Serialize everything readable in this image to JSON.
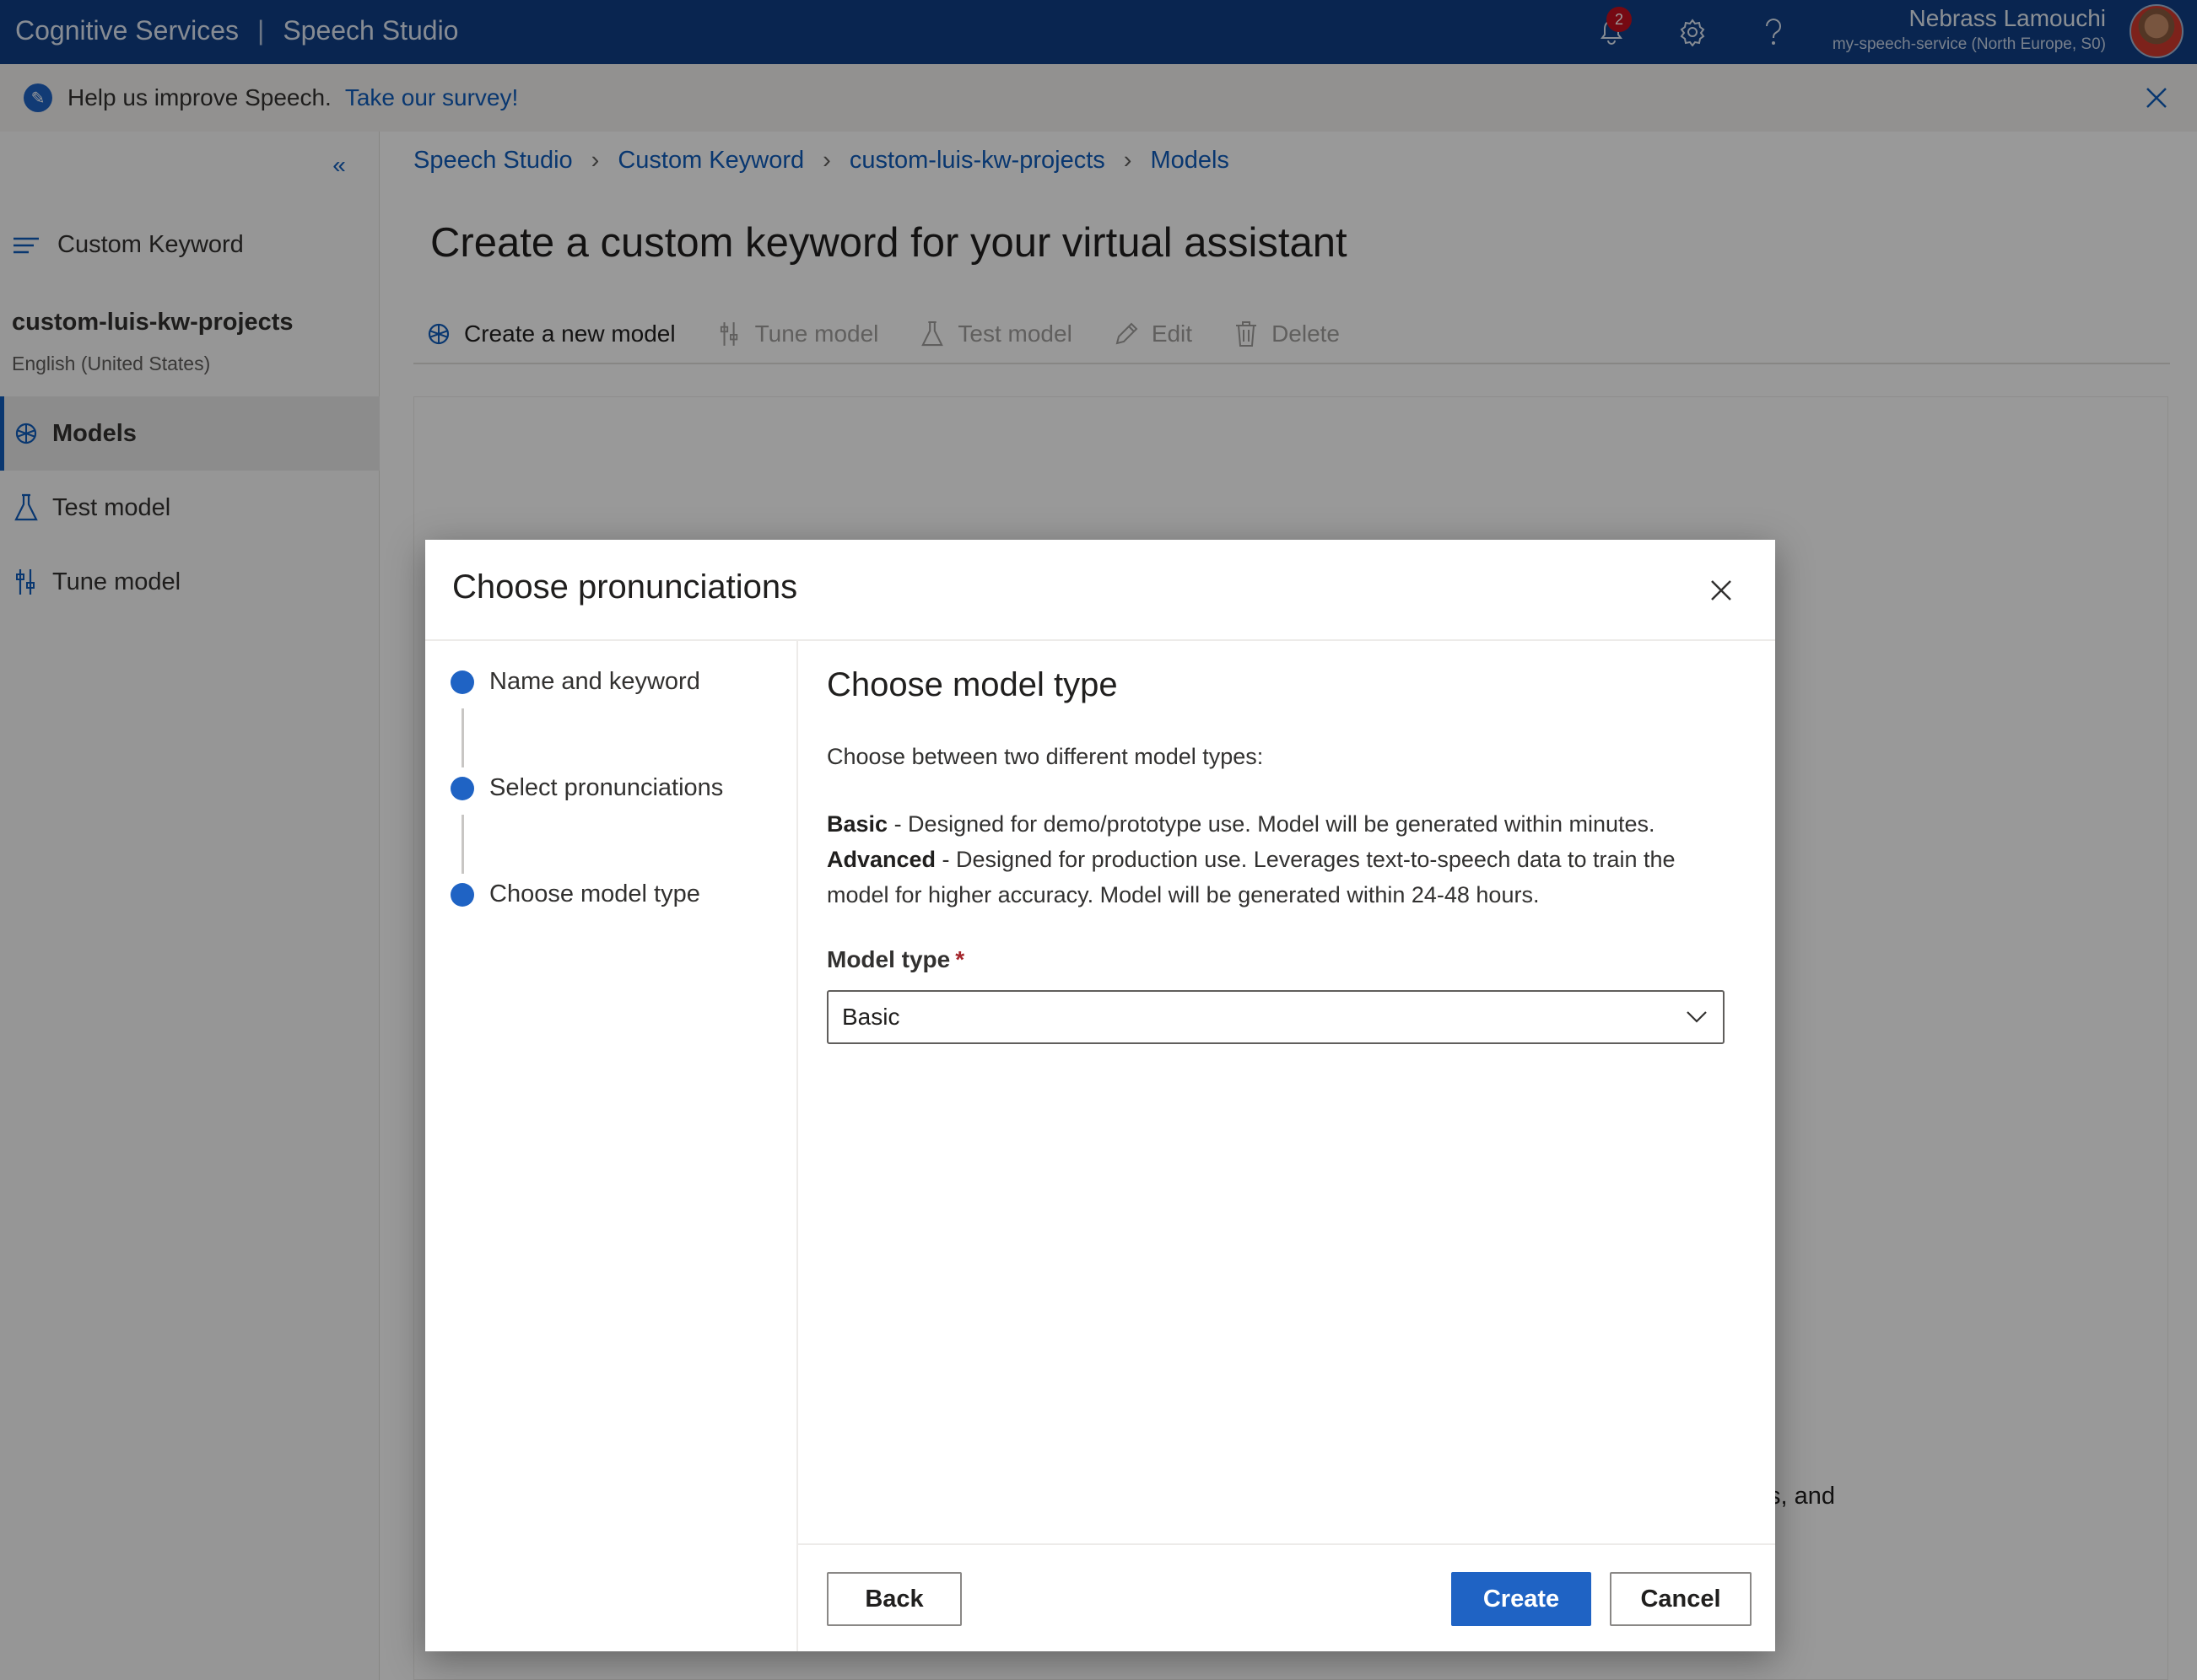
{
  "topbar": {
    "product": "Cognitive Services",
    "separator": "|",
    "app": "Speech Studio",
    "notification_count": "2",
    "user_name": "Nebrass Lamouchi",
    "user_service": "my-speech-service (North Europe, S0)",
    "icons": [
      "bell-icon",
      "gear-icon",
      "help-icon"
    ]
  },
  "banner": {
    "text": "Help us improve Speech.",
    "link": "Take our survey!"
  },
  "sidebar": {
    "collapse_glyph": "«",
    "header": "Custom Keyword",
    "project": "custom-luis-kw-projects",
    "language": "English (United States)",
    "items": [
      {
        "label": "Models",
        "active": true,
        "icon": "model-icon"
      },
      {
        "label": "Test model",
        "active": false,
        "icon": "flask-icon"
      },
      {
        "label": "Tune model",
        "active": false,
        "icon": "tune-icon"
      }
    ]
  },
  "breadcrumb": [
    "Speech Studio",
    "Custom Keyword",
    "custom-luis-kw-projects",
    "Models"
  ],
  "page_title": "Create a custom keyword for your virtual assistant",
  "toolbar": {
    "create": "Create a new model",
    "tune": "Tune model",
    "test": "Test model",
    "edit": "Edit",
    "delete": "Delete"
  },
  "background_fragment": "s, and",
  "dialog": {
    "title": "Choose pronunciations",
    "steps": [
      "Name and keyword",
      "Select pronunciations",
      "Choose model type"
    ],
    "section_title": "Choose model type",
    "intro": "Choose between two different model types:",
    "basic_label": "Basic",
    "basic_desc": " - Designed for demo/prototype use. Model will be generated within minutes.",
    "advanced_label": "Advanced",
    "advanced_desc": " - Designed for production use. Leverages text-to-speech data to train the model for higher accuracy. Model will be generated within 24-48 hours.",
    "field_label": "Model type",
    "required_mark": "*",
    "selected_value": "Basic",
    "buttons": {
      "back": "Back",
      "create": "Create",
      "cancel": "Cancel"
    }
  },
  "colors": {
    "topbar": "#0f3f85",
    "accent": "#1f63c4",
    "required": "#a4262c"
  }
}
